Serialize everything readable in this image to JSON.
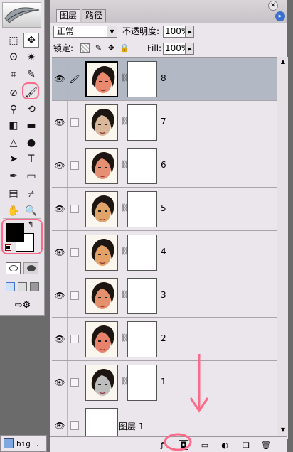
{
  "toolbox": {
    "logo": "PS",
    "tools": [
      {
        "name": "marquee-tool",
        "glyph": "⬚"
      },
      {
        "name": "move-tool",
        "glyph": "✥"
      },
      {
        "name": "lasso-tool",
        "glyph": "ʘ"
      },
      {
        "name": "magic-wand-tool",
        "glyph": "✷"
      },
      {
        "name": "crop-tool",
        "glyph": "⌗"
      },
      {
        "name": "slice-tool",
        "glyph": "✎"
      },
      {
        "name": "healing-brush-tool",
        "glyph": "⊘"
      },
      {
        "name": "brush-tool",
        "glyph": "🖌"
      },
      {
        "name": "clone-stamp-tool",
        "glyph": "⚲"
      },
      {
        "name": "history-brush-tool",
        "glyph": "⟲"
      },
      {
        "name": "eraser-tool",
        "glyph": "◧"
      },
      {
        "name": "gradient-tool",
        "glyph": "▬"
      },
      {
        "name": "blur-tool",
        "glyph": "△"
      },
      {
        "name": "dodge-tool",
        "glyph": "●"
      },
      {
        "name": "path-selection-tool",
        "glyph": "➤"
      },
      {
        "name": "type-tool",
        "glyph": "T"
      },
      {
        "name": "pen-tool",
        "glyph": "✒"
      },
      {
        "name": "shape-tool",
        "glyph": "▭"
      },
      {
        "name": "notes-tool",
        "glyph": "▤"
      },
      {
        "name": "eyedropper-tool",
        "glyph": "⌿"
      },
      {
        "name": "hand-tool",
        "glyph": "✋"
      },
      {
        "name": "zoom-tool",
        "glyph": "🔍"
      }
    ],
    "colors": {
      "foreground": "#000000",
      "background": "#ffffff"
    }
  },
  "panel": {
    "tabs": [
      {
        "label": "图层"
      },
      {
        "label": "路径"
      }
    ],
    "blend_mode": "正常",
    "opacity_label": "不透明度:",
    "opacity_value": "100%",
    "lock_label": "锁定:",
    "fill_label": "Fill:",
    "fill_value": "100%"
  },
  "layers": [
    {
      "name": "8",
      "active": true,
      "brush_icon": true,
      "has_mask": true,
      "thumb_tint": "#e98a6e"
    },
    {
      "name": "7",
      "active": false,
      "brush_icon": false,
      "has_mask": true,
      "thumb_tint": "#d9b89a"
    },
    {
      "name": "6",
      "active": false,
      "brush_icon": false,
      "has_mask": true,
      "thumb_tint": "#e58f73"
    },
    {
      "name": "5",
      "active": false,
      "brush_icon": false,
      "has_mask": true,
      "thumb_tint": "#e0a46a"
    },
    {
      "name": "4",
      "active": false,
      "brush_icon": false,
      "has_mask": true,
      "thumb_tint": "#e3a168"
    },
    {
      "name": "3",
      "active": false,
      "brush_icon": false,
      "has_mask": true,
      "thumb_tint": "#e5906d"
    },
    {
      "name": "2",
      "active": false,
      "brush_icon": false,
      "has_mask": true,
      "thumb_tint": "#e8826a"
    },
    {
      "name": "1",
      "active": false,
      "brush_icon": false,
      "has_mask": true,
      "thumb_tint": "#bdbdbd"
    },
    {
      "name": "图层 1",
      "active": false,
      "brush_icon": false,
      "has_mask": false,
      "thumb_tint": "#ffffff"
    }
  ],
  "taskbar": {
    "label": "big_."
  },
  "colors": {
    "annotation": "#ff6a8a",
    "active_row": "#b2b8c4",
    "panel_bg": "#ebe6eb"
  }
}
